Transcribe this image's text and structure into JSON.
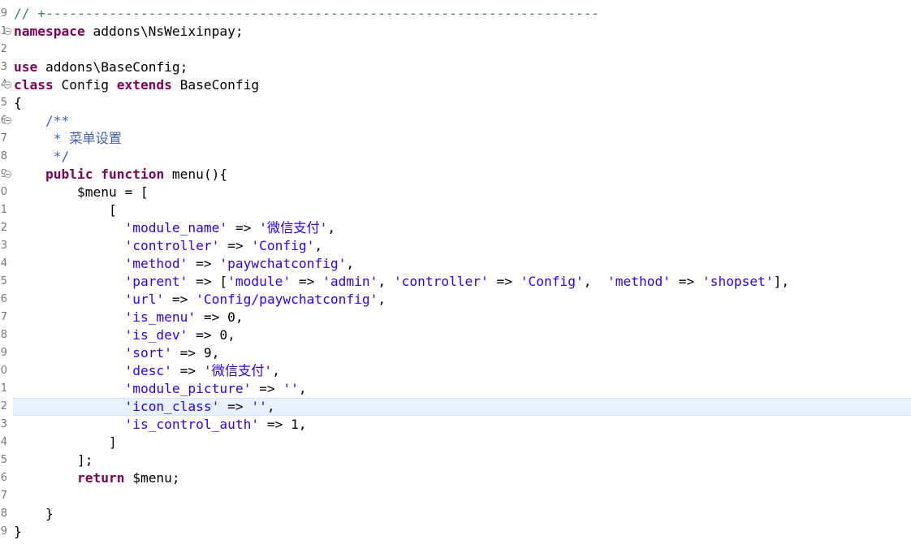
{
  "editor": {
    "lines": [
      {
        "num": "9",
        "fold": false,
        "current": false,
        "tokens": [
          {
            "t": "// +----------------------------------------------------------------------",
            "c": "cmline"
          }
        ]
      },
      {
        "num": "1",
        "fold": true,
        "current": false,
        "tokens": [
          {
            "t": "namespace",
            "c": "kw"
          },
          {
            "t": " addons\\NsWeixinpay;",
            "c": ""
          }
        ]
      },
      {
        "num": "2",
        "fold": false,
        "current": false,
        "tokens": []
      },
      {
        "num": "3",
        "fold": false,
        "current": false,
        "tokens": [
          {
            "t": "use",
            "c": "kw"
          },
          {
            "t": " addons\\BaseConfig;",
            "c": ""
          }
        ]
      },
      {
        "num": "4",
        "fold": true,
        "current": false,
        "tokens": [
          {
            "t": "class",
            "c": "kw"
          },
          {
            "t": " Config ",
            "c": ""
          },
          {
            "t": "extends",
            "c": "kw"
          },
          {
            "t": " BaseConfig",
            "c": ""
          }
        ]
      },
      {
        "num": "5",
        "fold": false,
        "current": false,
        "tokens": [
          {
            "t": "{",
            "c": ""
          }
        ]
      },
      {
        "num": "6",
        "fold": true,
        "current": false,
        "tokens": [
          {
            "t": "    /**",
            "c": "cm"
          }
        ]
      },
      {
        "num": "7",
        "fold": false,
        "current": false,
        "tokens": [
          {
            "t": "     * 菜单设置",
            "c": "cm"
          }
        ]
      },
      {
        "num": "8",
        "fold": false,
        "current": false,
        "tokens": [
          {
            "t": "     */",
            "c": "cm"
          }
        ]
      },
      {
        "num": "9",
        "fold": true,
        "current": false,
        "tokens": [
          {
            "t": "    ",
            "c": ""
          },
          {
            "t": "public",
            "c": "kw"
          },
          {
            "t": " ",
            "c": ""
          },
          {
            "t": "function",
            "c": "kw"
          },
          {
            "t": " menu(){",
            "c": ""
          }
        ]
      },
      {
        "num": "0",
        "fold": false,
        "current": false,
        "tokens": [
          {
            "t": "        $menu = [",
            "c": ""
          }
        ]
      },
      {
        "num": "1",
        "fold": false,
        "current": false,
        "tokens": [
          {
            "t": "            [",
            "c": ""
          }
        ]
      },
      {
        "num": "2",
        "fold": false,
        "current": false,
        "tokens": [
          {
            "t": "              ",
            "c": ""
          },
          {
            "t": "'module_name'",
            "c": "str"
          },
          {
            "t": " => ",
            "c": ""
          },
          {
            "t": "'微信支付'",
            "c": "str"
          },
          {
            "t": ",",
            "c": ""
          }
        ]
      },
      {
        "num": "3",
        "fold": false,
        "current": false,
        "tokens": [
          {
            "t": "              ",
            "c": ""
          },
          {
            "t": "'controller'",
            "c": "str"
          },
          {
            "t": " => ",
            "c": ""
          },
          {
            "t": "'Config'",
            "c": "str"
          },
          {
            "t": ",",
            "c": ""
          }
        ]
      },
      {
        "num": "4",
        "fold": false,
        "current": false,
        "tokens": [
          {
            "t": "              ",
            "c": ""
          },
          {
            "t": "'method'",
            "c": "str"
          },
          {
            "t": " => ",
            "c": ""
          },
          {
            "t": "'paywchatconfig'",
            "c": "str"
          },
          {
            "t": ",",
            "c": ""
          }
        ]
      },
      {
        "num": "5",
        "fold": false,
        "current": false,
        "tokens": [
          {
            "t": "              ",
            "c": ""
          },
          {
            "t": "'parent'",
            "c": "str"
          },
          {
            "t": " => [",
            "c": ""
          },
          {
            "t": "'module'",
            "c": "str"
          },
          {
            "t": " => ",
            "c": ""
          },
          {
            "t": "'admin'",
            "c": "str"
          },
          {
            "t": ", ",
            "c": ""
          },
          {
            "t": "'controller'",
            "c": "str"
          },
          {
            "t": " => ",
            "c": ""
          },
          {
            "t": "'Config'",
            "c": "str"
          },
          {
            "t": ",  ",
            "c": ""
          },
          {
            "t": "'method'",
            "c": "str"
          },
          {
            "t": " => ",
            "c": ""
          },
          {
            "t": "'shopset'",
            "c": "str"
          },
          {
            "t": "],",
            "c": ""
          }
        ]
      },
      {
        "num": "6",
        "fold": false,
        "current": false,
        "tokens": [
          {
            "t": "              ",
            "c": ""
          },
          {
            "t": "'url'",
            "c": "str"
          },
          {
            "t": " => ",
            "c": ""
          },
          {
            "t": "'Config/paywchatconfig'",
            "c": "str"
          },
          {
            "t": ",",
            "c": ""
          }
        ]
      },
      {
        "num": "7",
        "fold": false,
        "current": false,
        "tokens": [
          {
            "t": "              ",
            "c": ""
          },
          {
            "t": "'is_menu'",
            "c": "str"
          },
          {
            "t": " => 0,",
            "c": ""
          }
        ]
      },
      {
        "num": "8",
        "fold": false,
        "current": false,
        "tokens": [
          {
            "t": "              ",
            "c": ""
          },
          {
            "t": "'is_dev'",
            "c": "str"
          },
          {
            "t": " => 0,",
            "c": ""
          }
        ]
      },
      {
        "num": "9",
        "fold": false,
        "current": false,
        "tokens": [
          {
            "t": "              ",
            "c": ""
          },
          {
            "t": "'sort'",
            "c": "str"
          },
          {
            "t": " => 9,",
            "c": ""
          }
        ]
      },
      {
        "num": "0",
        "fold": false,
        "current": false,
        "tokens": [
          {
            "t": "              ",
            "c": ""
          },
          {
            "t": "'desc'",
            "c": "str"
          },
          {
            "t": " => ",
            "c": ""
          },
          {
            "t": "'微信支付'",
            "c": "str"
          },
          {
            "t": ",",
            "c": ""
          }
        ]
      },
      {
        "num": "1",
        "fold": false,
        "current": false,
        "tokens": [
          {
            "t": "              ",
            "c": ""
          },
          {
            "t": "'module_picture'",
            "c": "str"
          },
          {
            "t": " => ",
            "c": ""
          },
          {
            "t": "''",
            "c": "str"
          },
          {
            "t": ",",
            "c": ""
          }
        ]
      },
      {
        "num": "2",
        "fold": false,
        "current": true,
        "tokens": [
          {
            "t": "              ",
            "c": ""
          },
          {
            "t": "'icon_class'",
            "c": "str"
          },
          {
            "t": " => ",
            "c": ""
          },
          {
            "t": "''",
            "c": "str"
          },
          {
            "t": ",",
            "c": ""
          }
        ]
      },
      {
        "num": "3",
        "fold": false,
        "current": false,
        "tokens": [
          {
            "t": "              ",
            "c": ""
          },
          {
            "t": "'is_control_auth'",
            "c": "str"
          },
          {
            "t": " => 1,",
            "c": ""
          }
        ]
      },
      {
        "num": "4",
        "fold": false,
        "current": false,
        "tokens": [
          {
            "t": "            ]",
            "c": ""
          }
        ]
      },
      {
        "num": "5",
        "fold": false,
        "current": false,
        "tokens": [
          {
            "t": "        ];",
            "c": ""
          }
        ]
      },
      {
        "num": "6",
        "fold": false,
        "current": false,
        "tokens": [
          {
            "t": "        ",
            "c": ""
          },
          {
            "t": "return",
            "c": "kw"
          },
          {
            "t": " $menu;",
            "c": ""
          }
        ]
      },
      {
        "num": "7",
        "fold": false,
        "current": false,
        "tokens": []
      },
      {
        "num": "8",
        "fold": false,
        "current": false,
        "tokens": [
          {
            "t": "    }",
            "c": ""
          }
        ]
      },
      {
        "num": "9",
        "fold": false,
        "current": false,
        "tokens": [
          {
            "t": "}",
            "c": ""
          }
        ]
      }
    ]
  }
}
